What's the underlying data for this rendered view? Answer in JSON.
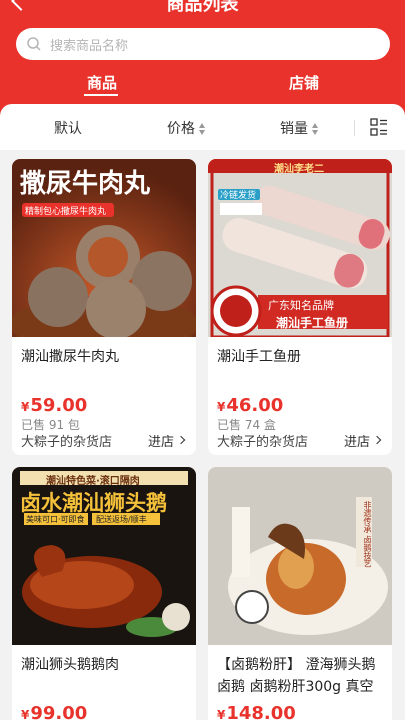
{
  "header": {
    "title": "商品列表",
    "search_placeholder": "搜索商品名称",
    "tabs": [
      "商品",
      "店铺"
    ]
  },
  "sort": {
    "items": [
      "默认",
      "价格",
      "销量"
    ]
  },
  "colors": {
    "brand": "#e8322b"
  },
  "products": [
    {
      "image_title": "撒尿牛肉丸",
      "image_sub": "精制包心撒尿牛肉丸",
      "name": "潮汕撒尿牛肉丸",
      "currency": "¥",
      "price": "59.00",
      "sold": "已售 91 包",
      "shop": "大粽子的杂货店",
      "enter": "进店"
    },
    {
      "image_title": "潮汕手工鱼册",
      "image_badge": "广东知名品牌",
      "image_tag": "冷链发货",
      "image_brand": "潮汕李老二",
      "name": "潮汕手工鱼册",
      "currency": "¥",
      "price": "46.00",
      "sold": "已售 74 盒",
      "shop": "大粽子的杂货店",
      "enter": "进店"
    },
    {
      "image_top": "潮汕特色菜·滚口隔肉",
      "image_title": "卤水潮汕狮头鹅",
      "image_tags": [
        "美味可口·可即食",
        "配送返场/顺丰"
      ],
      "name": "潮汕狮头鹅鹅肉",
      "currency": "¥",
      "price": "99.00"
    },
    {
      "image_title": "非遗传承 卤鹅技艺",
      "name": "【卤鹅粉肝】 澄海狮头鹅卤鹅 卤鹅粉肝300g 真空",
      "currency": "¥",
      "price": "148.00"
    }
  ]
}
